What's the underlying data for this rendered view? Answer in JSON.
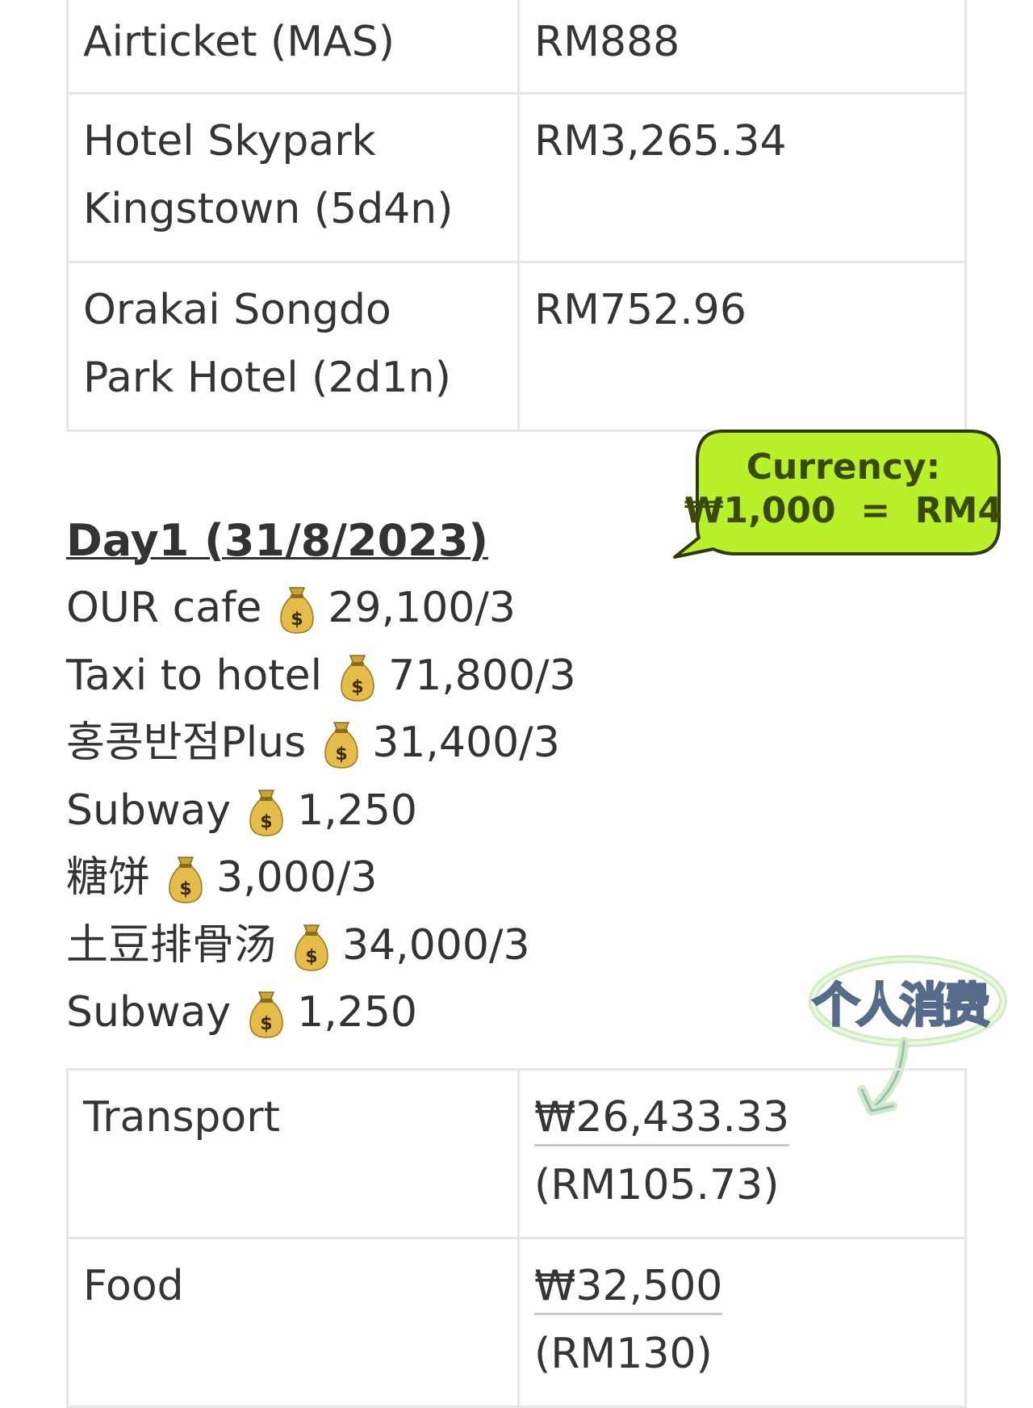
{
  "top_table": {
    "rows": [
      {
        "item": "Airticket (MAS)",
        "item_line2": "",
        "price": "RM888"
      },
      {
        "item": "Hotel Skypark",
        "item_line2": "Kingstown (5d4n)",
        "price": "RM3,265.34"
      },
      {
        "item": "Orakai Songdo",
        "item_line2": "Park Hotel (2d1n)",
        "price": "RM752.96"
      }
    ]
  },
  "currency_note": {
    "label": "Currency:",
    "rate": "₩1,000  =  RM4",
    "color": "#b8f02a"
  },
  "day1": {
    "title": "Day1 (31/8/2023)",
    "expenses": [
      {
        "name": "OUR cafe",
        "icon": "money-bag-icon",
        "amount": "29,100/3"
      },
      {
        "name": "Taxi to hotel",
        "icon": "money-bag-icon",
        "amount": "71,800/3"
      },
      {
        "name": "홍콩반점Plus",
        "icon": "money-bag-icon",
        "amount": "31,400/3"
      },
      {
        "name": "Subway",
        "icon": "money-bag-icon",
        "amount": "1,250"
      },
      {
        "name": "糖饼",
        "icon": "money-bag-icon",
        "amount": "3,000/3"
      },
      {
        "name": "土豆排骨汤",
        "icon": "money-bag-icon",
        "amount": "34,000/3"
      },
      {
        "name": "Subway",
        "icon": "money-bag-icon",
        "amount": "1,250"
      }
    ]
  },
  "personal_sticker": {
    "label": "个人消费",
    "icon": "curved-arrow-icon"
  },
  "bottom_table": {
    "rows": [
      {
        "category": "Transport",
        "won": "₩26,433.33",
        "rm": "(RM105.73)"
      },
      {
        "category": "Food",
        "won": "₩32,500",
        "rm": "(RM130)"
      }
    ]
  }
}
